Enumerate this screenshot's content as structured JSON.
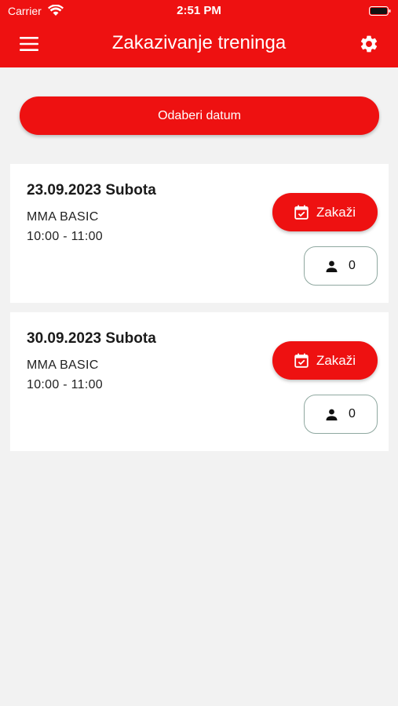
{
  "status_bar": {
    "carrier": "Carrier",
    "time": "2:51 PM",
    "wifi_icon": "wifi-icon",
    "battery_icon": "battery-icon"
  },
  "app_bar": {
    "title": "Zakazivanje treninga",
    "menu_icon": "menu-icon",
    "settings_icon": "gear-icon"
  },
  "pick_date_label": "Odaberi datum",
  "trainings": [
    {
      "date": "23.09.2023 Subota",
      "name": "MMA BASIC",
      "time": "10:00 - 11:00",
      "book_label": "Zakaži",
      "participants": "0"
    },
    {
      "date": "30.09.2023 Subota",
      "name": "MMA BASIC",
      "time": "10:00 - 11:00",
      "book_label": "Zakaži",
      "participants": "0"
    }
  ],
  "colors": {
    "accent": "#ee1111",
    "background": "#f2f2f2",
    "card": "#ffffff",
    "outline": "#8fa8a0"
  }
}
